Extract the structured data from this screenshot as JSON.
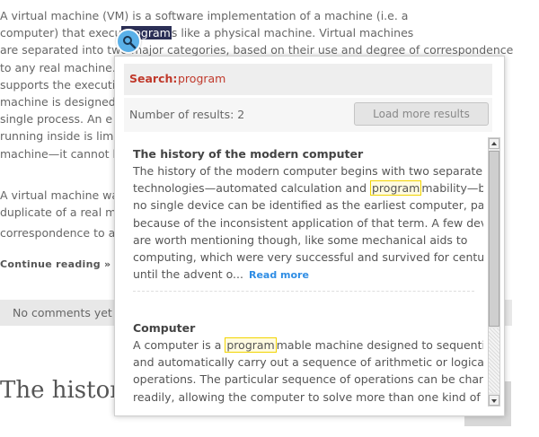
{
  "article": {
    "para1": [
      "A virtual machine (VM) is a software implementation of a machine (i.e. a",
      [
        "computer) that execu",
        "program",
        "s like a physical machine. Virtual machines"
      ],
      "are separated into two major categories, based on their use and degree of correspondence",
      "to any real machine.",
      "supports the executi",
      "machine is designed",
      "single process. An e",
      "running inside is lim",
      "machine—it cannot b"
    ],
    "para2": [
      "A virtual machine wa",
      "duplicate of a real m",
      "correspondence to a"
    ],
    "continue_label": "Continue reading »",
    "comments_label": "No comments yet",
    "next_title": "The histor"
  },
  "popup": {
    "search_label": "Search:",
    "search_term": "program",
    "results_count": "Number of results: 2",
    "load_more_label": "Load more results",
    "results": [
      {
        "title": "The history of the modern computer",
        "lines": [
          "The history of the modern computer begins with two separate",
          [
            "technologies—automated calculation and ",
            "program",
            "mability—but"
          ],
          "no single device can be identified as the earliest computer, partly",
          "because of the inconsistent application of that term. A few devices",
          "are worth mentioning though, like some mechanical aids to",
          "computing, which were very successful and survived for centuries",
          "until the advent o..."
        ],
        "read_more": "Read more"
      },
      {
        "title": "Computer",
        "lines": [
          [
            "A computer is a ",
            "program",
            "mable machine designed to sequentially"
          ],
          "and automatically carry out a sequence of arithmetic or logical",
          "operations. The particular sequence of operations can be changed",
          "readily, allowing the computer to solve more than one kind of"
        ]
      }
    ]
  },
  "colors": {
    "search_accent": "#c0392b",
    "link_blue": "#2f8de4",
    "keyword_border": "#f2d400",
    "selection_bg": "#2b2f56",
    "magnifier_blue": "#5ab0e8"
  },
  "icons": {
    "magnifier": "magnifier-icon",
    "scroll_up": "arrow-up-icon",
    "scroll_down": "arrow-down-icon"
  }
}
